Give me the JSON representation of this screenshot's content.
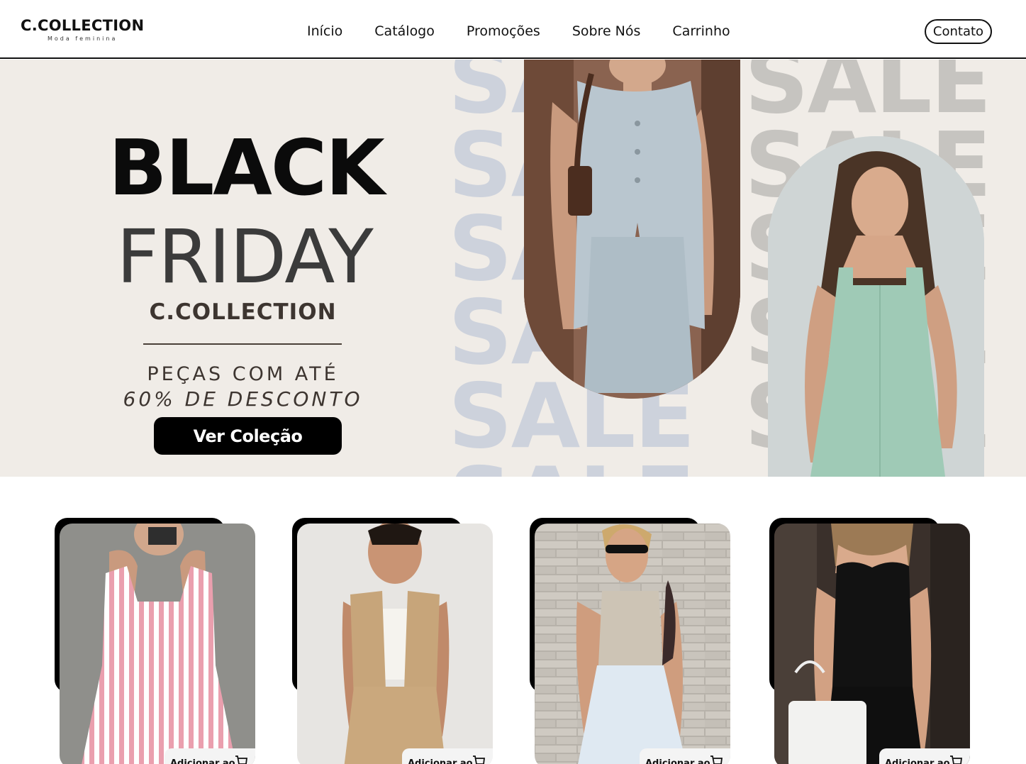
{
  "header": {
    "logo": {
      "name": "C.COLLECTION",
      "tagline": "Moda feminina"
    },
    "nav": [
      "Início",
      "Catálogo",
      "Promoções",
      "Sobre Nós",
      "Carrinho"
    ],
    "contact_label": "Contato"
  },
  "hero": {
    "title_line1": "BLACK",
    "title_line2": "FRIDAY",
    "brand": "C.COLLECTION",
    "promo_line1": "PEÇAS COM ATÉ",
    "promo_line2": "60% DE DESCONTO",
    "cta_label": "Ver Coleção",
    "background_word": "SALE"
  },
  "products": [
    {
      "add_label": "Adicionar ao"
    },
    {
      "add_label": "Adicionar ao"
    },
    {
      "add_label": "Adicionar ao"
    },
    {
      "add_label": "Adicionar ao"
    }
  ],
  "colors": {
    "hero_bg": "#f0ece7",
    "accent": "#000000",
    "sale_left": "#cdd2dc",
    "sale_right": "#c6c4c0"
  }
}
